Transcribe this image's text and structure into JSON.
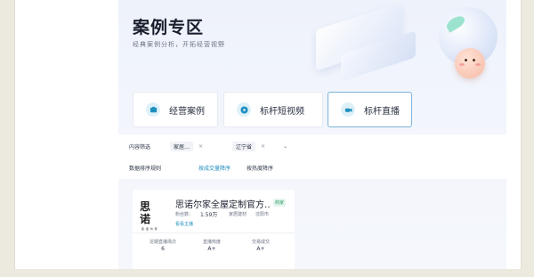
{
  "hero": {
    "title": "案例专区",
    "subtitle": "经典案例分析，开拓经营视野"
  },
  "categories": [
    {
      "label": "经营案例",
      "icon": "case-icon"
    },
    {
      "label": "标杆短视频",
      "icon": "video-play-icon"
    },
    {
      "label": "标杆直播",
      "icon": "live-camera-icon",
      "active": true
    }
  ],
  "filters": {
    "content_label": "内容筛选",
    "select1_tag": "家居…",
    "select2_tag": "辽宁省",
    "sort_label": "数据排序规则",
    "sort_options": [
      "按成交量降序",
      "按热度降序"
    ],
    "active_sort": "按成交量降序"
  },
  "case": {
    "logo_mark": "思诺",
    "logo_brand": "思·诺·尔·家",
    "name": "思诺尔家全屋定制官方…",
    "badge": "商家",
    "fans_label": "粉丝数：",
    "fans_value": "1.59万",
    "category": "家居建材",
    "city": "沈阳市",
    "link": "看看主播",
    "stats": [
      {
        "label": "近期直播场次",
        "value": "6"
      },
      {
        "label": "直播热度",
        "value": "A+"
      },
      {
        "label": "交易成交",
        "value": "A+"
      }
    ]
  },
  "colors": {
    "accent": "#1f8fbf",
    "active_border": "#7db3d8",
    "badge_green": "#2a9a6a"
  }
}
